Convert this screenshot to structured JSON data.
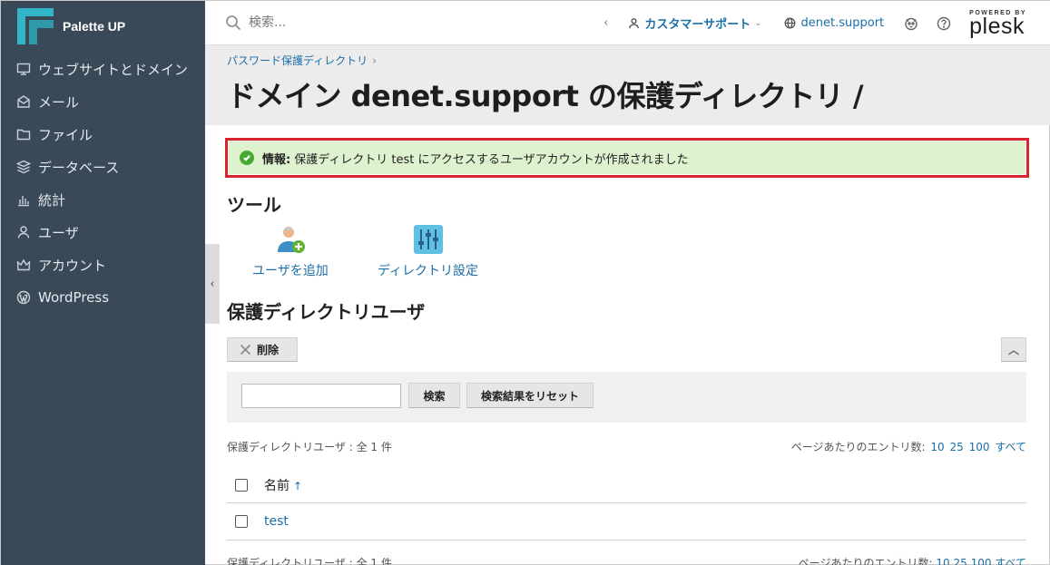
{
  "brand": {
    "name": "Palette UP"
  },
  "sidebar": {
    "items": [
      {
        "label": "ウェブサイトとドメイン",
        "icon": "monitor-icon"
      },
      {
        "label": "メール",
        "icon": "envelope-icon"
      },
      {
        "label": "ファイル",
        "icon": "folder-icon"
      },
      {
        "label": "データベース",
        "icon": "database-icon"
      },
      {
        "label": "統計",
        "icon": "bar-chart-icon"
      },
      {
        "label": "ユーザ",
        "icon": "user-icon"
      },
      {
        "label": "アカウント",
        "icon": "crown-icon"
      },
      {
        "label": "WordPress",
        "icon": "wordpress-icon"
      }
    ]
  },
  "header": {
    "search_placeholder": "検索...",
    "user_menu": "カスタマーサポート",
    "site": "denet.support",
    "powered_by": "POWERED BY",
    "product": "plesk"
  },
  "breadcrumb": {
    "item": "パスワード保護ディレクトリ"
  },
  "page_title": "ドメイン denet.support の保護ディレクトリ /",
  "alert": {
    "label": "情報:",
    "message": "保護ディレクトリ test にアクセスするユーザアカウントが作成されました"
  },
  "tools": {
    "heading": "ツール",
    "add_user": "ユーザを追加",
    "dir_settings": "ディレクトリ設定"
  },
  "users": {
    "heading": "保護ディレクトリユーザ",
    "delete_label": "削除",
    "search_label": "検索",
    "reset_label": "検索結果をリセット",
    "search_value": "",
    "count_text": "保護ディレクトリユーザ : 全 1 件",
    "per_page_label": "ページあたりのエントリ数:",
    "per_page_options": [
      "10",
      "25",
      "100",
      "すべて"
    ],
    "column_name": "名前",
    "rows": [
      {
        "name": "test"
      }
    ]
  }
}
